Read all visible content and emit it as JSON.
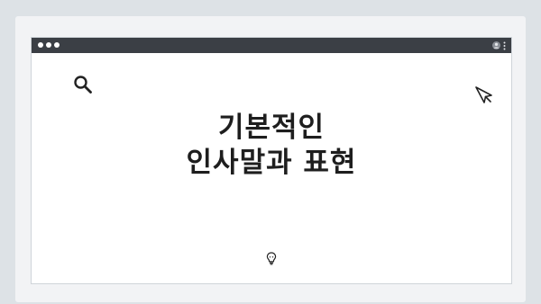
{
  "page": {
    "headline_line1": "기본적인",
    "headline_line2": "인사말과 표현"
  },
  "icons": {
    "top_dots": [
      "dot",
      "dot",
      "dot",
      "dot"
    ],
    "titlebar_left": [
      "traffic-dot",
      "traffic-dot",
      "traffic-dot"
    ],
    "titlebar_right": [
      "user-icon",
      "more-icon"
    ],
    "content": [
      "search-icon",
      "cursor-icon",
      "lightbulb-icon"
    ]
  },
  "colors": {
    "titlebar": "#3b3f45",
    "background": "#dde2e6",
    "window": "#ffffff",
    "text": "#1e1e1e"
  }
}
